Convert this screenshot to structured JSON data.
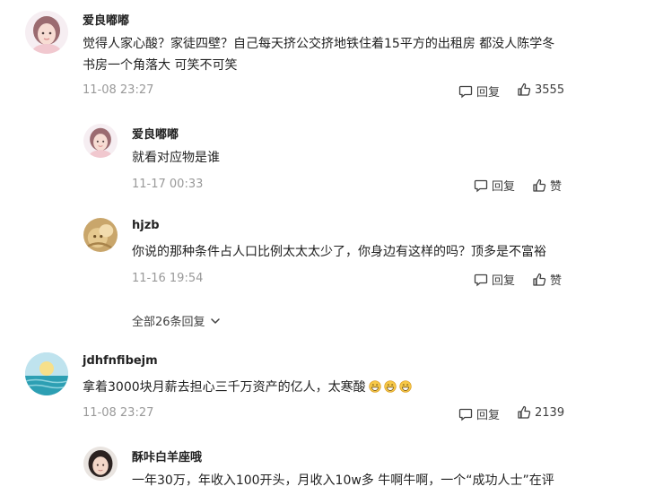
{
  "comments": [
    {
      "user": "爱良嘟嘟",
      "text_line1": "觉得人家心酸？家徒四壁？自己每天挤公交挤地铁住着15平方的出租房 都没人陈学冬",
      "text_line2": "书房一个角落大 可笑不可笑",
      "time": "11-08 23:27",
      "reply_label": "回复",
      "like_count": "3555",
      "avatar_icon": "girl-avatar-icon"
    },
    {
      "user": "jdhfnfibejm",
      "text": "拿着3000块月薪去担心三千万资产的亿人，太寒酸",
      "emoji_icon": "grin-emoji-icon",
      "time": "11-08 23:27",
      "reply_label": "回复",
      "like_count": "2139",
      "avatar_icon": "sunset-sea-avatar-icon"
    }
  ],
  "replies": [
    {
      "user": "爱良嘟嘟",
      "text": "就看对应物是谁",
      "time": "11-17 00:33",
      "reply_label": "回复",
      "like_label": "赞"
    },
    {
      "user": "hjzb",
      "text": "你说的那种条件占人口比例太太太少了，你身边有这样的吗？顶多是不富裕",
      "time": "11-16 19:54",
      "reply_label": "回复",
      "like_label": "赞"
    },
    {
      "user": "酥咔白羊座哦",
      "text": "一年30万，年收入100开头，月收入10w多 牛啊牛啊，一个“成功人士”在评"
    }
  ],
  "show_all_replies": "全部26条回复",
  "colors": {
    "text": "#222222",
    "time": "#999999",
    "action": "#404040",
    "background": "#ffffff"
  }
}
